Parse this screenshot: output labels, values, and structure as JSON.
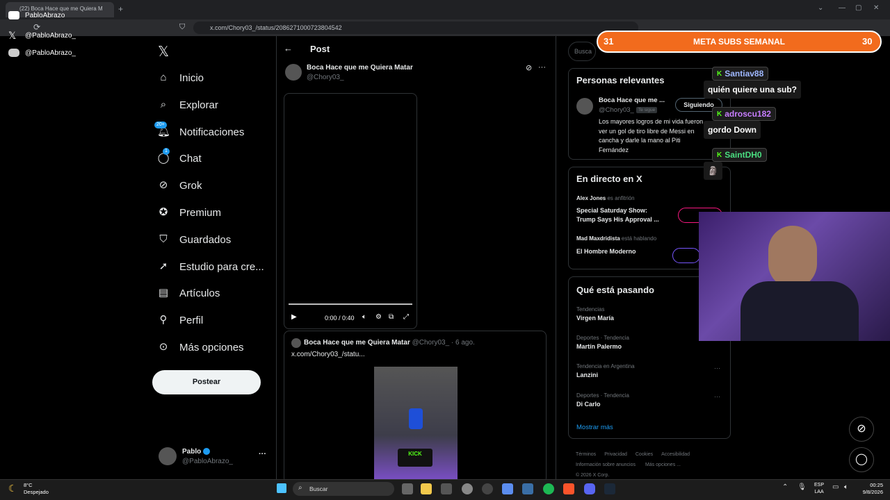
{
  "browser": {
    "tab_title": "(22) Boca Hace que me Quiera M",
    "new_tab": "+",
    "url": "x.com/Chory03_/status/2086271000723804542"
  },
  "overlay_socials": [
    {
      "icon": "youtube-icon",
      "label": "PabloAbrazo"
    },
    {
      "icon": "x-logo-icon",
      "label": "@PabloAbrazo_"
    },
    {
      "icon": "discord-icon",
      "label": "@PabloAbrazo_"
    }
  ],
  "sidebar": {
    "items": [
      {
        "label": "Inicio",
        "icon": "home-icon"
      },
      {
        "label": "Explorar",
        "icon": "search-icon"
      },
      {
        "label": "Notificaciones",
        "icon": "bell-icon",
        "badge": "20+"
      },
      {
        "label": "Chat",
        "icon": "chat-icon",
        "badge": "1"
      },
      {
        "label": "Grok",
        "icon": "grok-icon"
      },
      {
        "label": "Premium",
        "icon": "premium-icon"
      },
      {
        "label": "Guardados",
        "icon": "bookmark-icon"
      },
      {
        "label": "Estudio para cre...",
        "icon": "rocket-icon"
      },
      {
        "label": "Artículos",
        "icon": "article-icon"
      },
      {
        "label": "Perfil",
        "icon": "person-icon"
      },
      {
        "label": "Más opciones",
        "icon": "more-circle-icon"
      }
    ],
    "post_button": "Postear",
    "account": {
      "name": "Pablo",
      "handle": "@PabloAbrazo_",
      "more": "···"
    }
  },
  "post": {
    "header": "Post",
    "author_name": "Boca Hace que me Quiera Matar",
    "author_handle": "@Chory03_",
    "video": {
      "time": "0:00 / 0:40"
    },
    "quote": {
      "author_name": "Boca Hace que me Quiera Matar",
      "author_handle": "@Chory03_",
      "date": "· 6 ago.",
      "text": "x.com/Chory03_/statu...",
      "watermark": "KICK"
    }
  },
  "right": {
    "search_placeholder": "Busca",
    "relevant": {
      "title": "Personas relevantes",
      "name": "Boca Hace que me ...",
      "handle": "@Chory03_",
      "follows_you": "Te sigue",
      "follow_button": "Siguiendo",
      "bio": [
        "Los mayores logros de mi vida fueron",
        "ver un gol de tiro libre de Messi en",
        "cancha y darle la mano al Piti",
        "Fernández"
      ]
    },
    "live": {
      "title": "En directo en X",
      "items": [
        {
          "host": "Alex Jones",
          "role": "es anfitrión",
          "title_line1": "Special Saturday Show:",
          "title_line2": "Trump Says His Approval ..."
        },
        {
          "host": "Mad Maxdridista",
          "role": "está hablando",
          "title_line1": "El Hombre Moderno",
          "title_line2": ""
        }
      ]
    },
    "trends": {
      "title": "Qué está pasando",
      "items": [
        {
          "context": "Tendencias",
          "name": "Virgen María"
        },
        {
          "context": "Deportes · Tendencia",
          "name": "Martín Palermo"
        },
        {
          "context": "Tendencia en Argentina",
          "name": "Lanzini"
        },
        {
          "context": "Deportes · Tendencia",
          "name": "Di Carlo"
        }
      ],
      "show_more": "Mostrar más"
    },
    "footer": {
      "line1": [
        "Términos",
        "Privacidad",
        "Cookies",
        "Accesibilidad"
      ],
      "line2": [
        "Información sobre anuncios",
        "Más opciones ..."
      ],
      "line3": "© 2026 X Corp."
    }
  },
  "stream_overlay": {
    "goal": {
      "left": "31",
      "title": "META SUBS SEMANAL",
      "right": "30"
    },
    "chat": [
      {
        "user": "Santiav88",
        "color": "#9fb8ff",
        "message": "quién quiere una sub?"
      },
      {
        "user": "adroscu182",
        "color": "#c77dff",
        "message": "gordo Down"
      },
      {
        "user": "SaintDH0",
        "color": "#4ade80",
        "message": "🗿"
      }
    ]
  },
  "taskbar": {
    "weather_temp": "8°C",
    "weather_desc": "Despejado",
    "search": "Buscar",
    "lang1": "ESP",
    "lang2": "LAA",
    "time": "00:25",
    "date": "9/8/2026"
  }
}
